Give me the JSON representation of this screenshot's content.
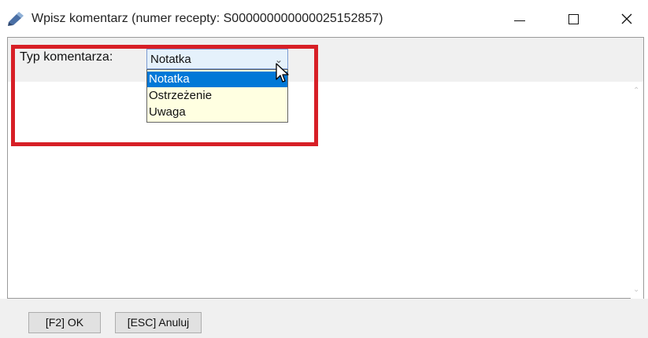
{
  "window": {
    "title": "Wpisz komentarz (numer recepty: S000000000000025152857)",
    "icon": "pen-icon",
    "controls": [
      "minimize-icon",
      "maximize-icon",
      "close-icon"
    ]
  },
  "comment_type": {
    "label": "Typ komentarza:",
    "selected": "Notatka",
    "options": [
      "Notatka",
      "Ostrzeżenie",
      "Uwaga"
    ]
  },
  "footer": {
    "ok_label": "[F2] OK",
    "cancel_label": "[ESC] Anuluj"
  },
  "colors": {
    "highlight": "#0078d7",
    "annotation_box": "#d71f26",
    "dropdown_bg": "#ffffe1"
  }
}
